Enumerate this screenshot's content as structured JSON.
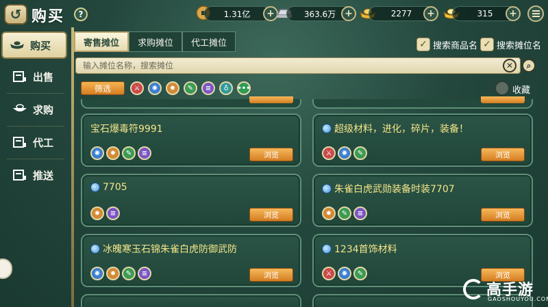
{
  "header": {
    "back_icon": "back-arrow-icon",
    "title": "购买",
    "help": "?",
    "currencies": [
      {
        "icon": "copper-coin-icon",
        "value": "1.31亿"
      },
      {
        "icon": "silver-ingot-icon",
        "value": "363.6万"
      },
      {
        "icon": "gold-ingot-icon",
        "value": "2277"
      },
      {
        "icon": "gold-yuanbao-icon",
        "value": "315"
      }
    ],
    "plus": "+"
  },
  "sidebar": {
    "items": [
      {
        "label": "购买",
        "icon": "ingot-icon"
      },
      {
        "label": "出售",
        "icon": "stall-icon"
      },
      {
        "label": "求购",
        "icon": "bowl-icon"
      },
      {
        "label": "代工",
        "icon": "stall-icon"
      },
      {
        "label": "推送",
        "icon": "stall-icon"
      }
    ]
  },
  "tabs": [
    "寄售摊位",
    "求购摊位",
    "代工摊位"
  ],
  "checkboxes": [
    {
      "label": "搜索商品名",
      "checked": true
    },
    {
      "label": "搜索摊位名",
      "checked": true
    }
  ],
  "search": {
    "placeholder": "输入摊位名称，搜索摊位"
  },
  "filter": {
    "label": "筛选",
    "favorite_label": "收藏"
  },
  "stalls": [
    {
      "name": "宝石爆毒符9991",
      "view": "浏览"
    },
    {
      "name": "超级材料，进化，碎片，装备！",
      "view": "浏览"
    },
    {
      "name": "7705",
      "view": "浏览"
    },
    {
      "name": "朱雀白虎武勋装备时装7707",
      "view": "浏览"
    },
    {
      "name": "冰魄寒玉石锦朱雀白虎防御武防",
      "view": "浏览"
    },
    {
      "name": "1234首饰材料",
      "view": "浏览"
    }
  ],
  "watermark": {
    "text": "高手游",
    "sub": "GAOSHOUYOU.COM"
  }
}
